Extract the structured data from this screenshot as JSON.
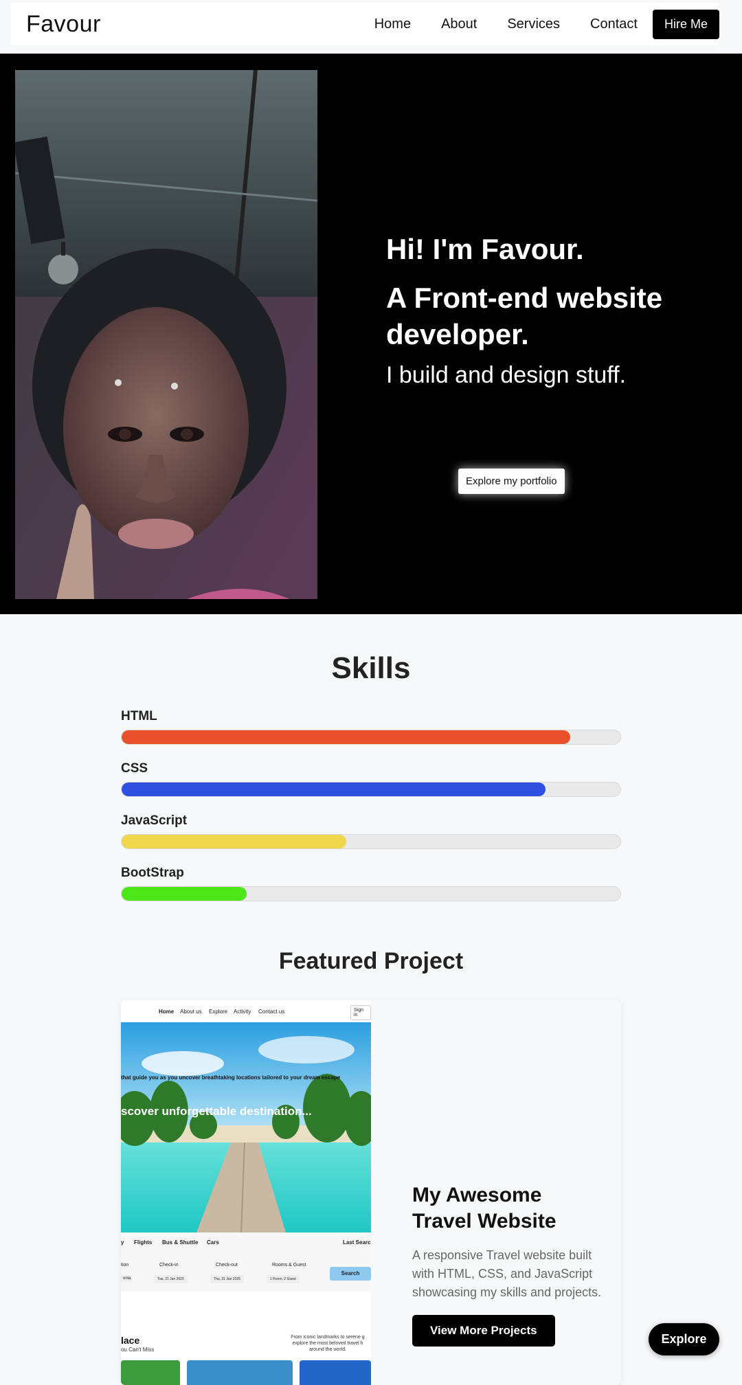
{
  "header": {
    "logo": "Favour",
    "nav": [
      "Home",
      "About",
      "Services",
      "Contact"
    ],
    "hire_label": "Hire Me"
  },
  "hero": {
    "greeting": "Hi! I'm Favour.",
    "role": "A Front-end website developer.",
    "tagline": "I build and design stuff.",
    "cta_label": "Explore my portfolio"
  },
  "skills": {
    "title": "Skills",
    "items": [
      {
        "name": "HTML",
        "level": 0.9,
        "color": "#e8512b"
      },
      {
        "name": "CSS",
        "level": 0.85,
        "color": "#2f4fe0"
      },
      {
        "name": "JavaScript",
        "level": 0.45,
        "color": "#f0d64a"
      },
      {
        "name": "BootStrap",
        "level": 0.25,
        "color": "#4de619"
      }
    ]
  },
  "project": {
    "section_title": "Featured Project",
    "title": "My Awesome Travel Website",
    "description": "A responsive Travel website built with HTML, CSS, and JavaScript showcasing my skills and projects.",
    "button_label": "View More Projects",
    "preview": {
      "nav": [
        "Home",
        "About us",
        "Explore",
        "Activity",
        "Contact us"
      ],
      "signin": "Sign in",
      "subtitle": "that guide you as you uncover breathtaking locations tailored to your dream escape",
      "headline": "scover unforgettable destination...",
      "tabs": [
        "y",
        "Flights",
        "Bus & Shuttle",
        "Cars"
      ],
      "last_search": "Last Searc",
      "fields": [
        {
          "label": "tion",
          "value": "onia"
        },
        {
          "label": "Check-in",
          "value": "Tue, 21 Jan 2025"
        },
        {
          "label": "Check-out",
          "value": "Thu, 31 Jan 2025"
        },
        {
          "label": "Rooms & Guest",
          "value": "1 Room, 2 Guest"
        }
      ],
      "search_label": "Search",
      "place_title": "lace",
      "place_sub": "ou Can't Miss",
      "place_text": "From iconic landmarks to serene g explore the most beloved travel h around the world."
    }
  },
  "fab_label": "Explore"
}
